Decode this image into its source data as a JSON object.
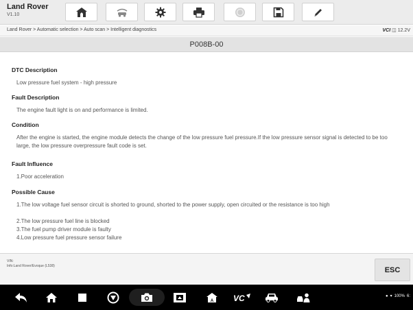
{
  "app": {
    "name": "Land Rover",
    "version": "V1.10"
  },
  "toolbar": {
    "buttons": [
      {
        "icon": "home-icon"
      },
      {
        "icon": "vehicle-swap-icon"
      },
      {
        "icon": "settings-gear-icon"
      },
      {
        "icon": "print-icon"
      },
      {
        "icon": "help-circle-icon"
      },
      {
        "icon": "save-icon"
      },
      {
        "icon": "edit-pen-icon"
      }
    ]
  },
  "breadcrumb": "Land Rover > Automatic selection > Auto scan > Intelligent diagnostics",
  "vci": {
    "label": "VCI",
    "voltage": "12.2V"
  },
  "page_title": "P008B-00",
  "sections": {
    "dtc_description": {
      "heading": "DTC Description",
      "text": "Low pressure fuel system - high pressure"
    },
    "fault_description": {
      "heading": "Fault Description",
      "text": "The engine fault light is on and performance is limited."
    },
    "condition": {
      "heading": "Condition",
      "text": "After the engine is started, the engine module detects the change of the low pressure fuel pressure.If the low pressure sensor signal is detected to be too large, the low pressure overpressure fault code is set."
    },
    "fault_influence": {
      "heading": "Fault Influence",
      "text": "1.Poor acceleration"
    },
    "possible_cause": {
      "heading": "Possible Cause",
      "items": [
        "1.The low voltage fuel sensor circuit is shorted to ground, shorted to the power supply, open circuited or the resistance is too high",
        "2.The low pressure fuel line is blocked",
        "3.The fuel pump driver module is faulty",
        "4.Low pressure fuel pressure sensor failure"
      ]
    }
  },
  "footer": {
    "vin_label": "VIN:",
    "info": "Info:Land Rover/Evoque (L538)",
    "esc_label": "ESC"
  },
  "navbar": {
    "icons": [
      "back-icon",
      "home-icon",
      "recent-apps-icon",
      "browser-icon",
      "camera-icon",
      "screenshot-icon",
      "autel-home-icon",
      "vci-icon",
      "car-icon",
      "remote-support-icon"
    ],
    "status": {
      "battery": "100%",
      "time": "6:"
    }
  },
  "colors": {
    "toolbar_bg": "#ececec",
    "title_bg": "#e3e3e3",
    "navbar_bg": "#000000"
  }
}
